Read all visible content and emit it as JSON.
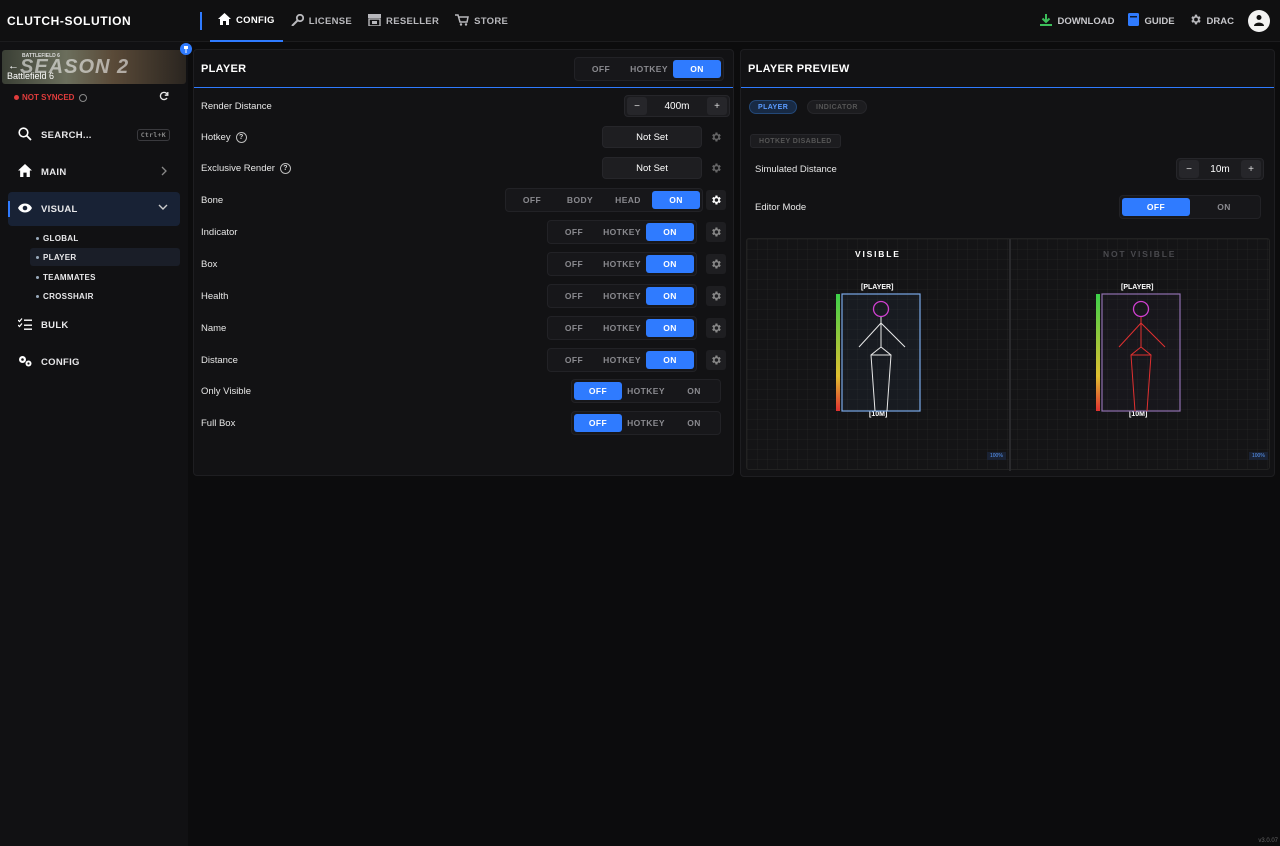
{
  "brand": "CLUTCH-SOLUTION",
  "nav": [
    {
      "label": "CONFIG",
      "icon": "home-icon",
      "active": true
    },
    {
      "label": "LICENSE",
      "icon": "key-icon"
    },
    {
      "label": "RESELLER",
      "icon": "store-icon"
    },
    {
      "label": "STORE",
      "icon": "cart-icon"
    }
  ],
  "nav_right": {
    "download": "DOWNLOAD",
    "guide": "GUIDE",
    "user": "DRAC"
  },
  "sidebar": {
    "banner_small": "BATTLEFIELD 6",
    "banner_season": "SEASON 2",
    "banner_label": "Battlefield 6",
    "sync_status": "NOT SYNCED",
    "search_label": "SEARCH...",
    "search_kbd": "Ctrl+K",
    "main_label": "MAIN",
    "visual_label": "VISUAL",
    "sub": [
      "GLOBAL",
      "PLAYER",
      "TEAMMATES",
      "CROSSHAIR"
    ],
    "bulk_label": "BULK",
    "config_label": "CONFIG",
    "version": "v3.0.07"
  },
  "player": {
    "title": "PLAYER",
    "mode": [
      "OFF",
      "HOTKEY",
      "ON"
    ],
    "render_distance_label": "Render Distance",
    "render_distance_value": "400m",
    "hotkey_label": "Hotkey",
    "hotkey_value": "Not Set",
    "exclusive_label": "Exclusive Render",
    "exclusive_value": "Not Set",
    "bone_label": "Bone",
    "bone_options": [
      "OFF",
      "BODY",
      "HEAD",
      "ON"
    ],
    "rows": [
      {
        "label": "Indicator"
      },
      {
        "label": "Box"
      },
      {
        "label": "Health"
      },
      {
        "label": "Name"
      },
      {
        "label": "Distance"
      }
    ],
    "only_visible_label": "Only Visible",
    "full_box_label": "Full Box",
    "tri": [
      "OFF",
      "HOTKEY",
      "ON"
    ]
  },
  "preview": {
    "title": "PLAYER PREVIEW",
    "tab_player": "PLAYER",
    "tab_indicator": "INDICATOR",
    "hotkey_disabled": "HOTKEY DISABLED",
    "sim_label": "Simulated Distance",
    "sim_value": "10m",
    "editor_label": "Editor Mode",
    "editor_off": "OFF",
    "editor_on": "ON",
    "visible": "VISIBLE",
    "not_visible": "NOT VISIBLE",
    "tag_player": "[PLAYER]",
    "tag_dist": "[10M]",
    "pct": "100%"
  }
}
